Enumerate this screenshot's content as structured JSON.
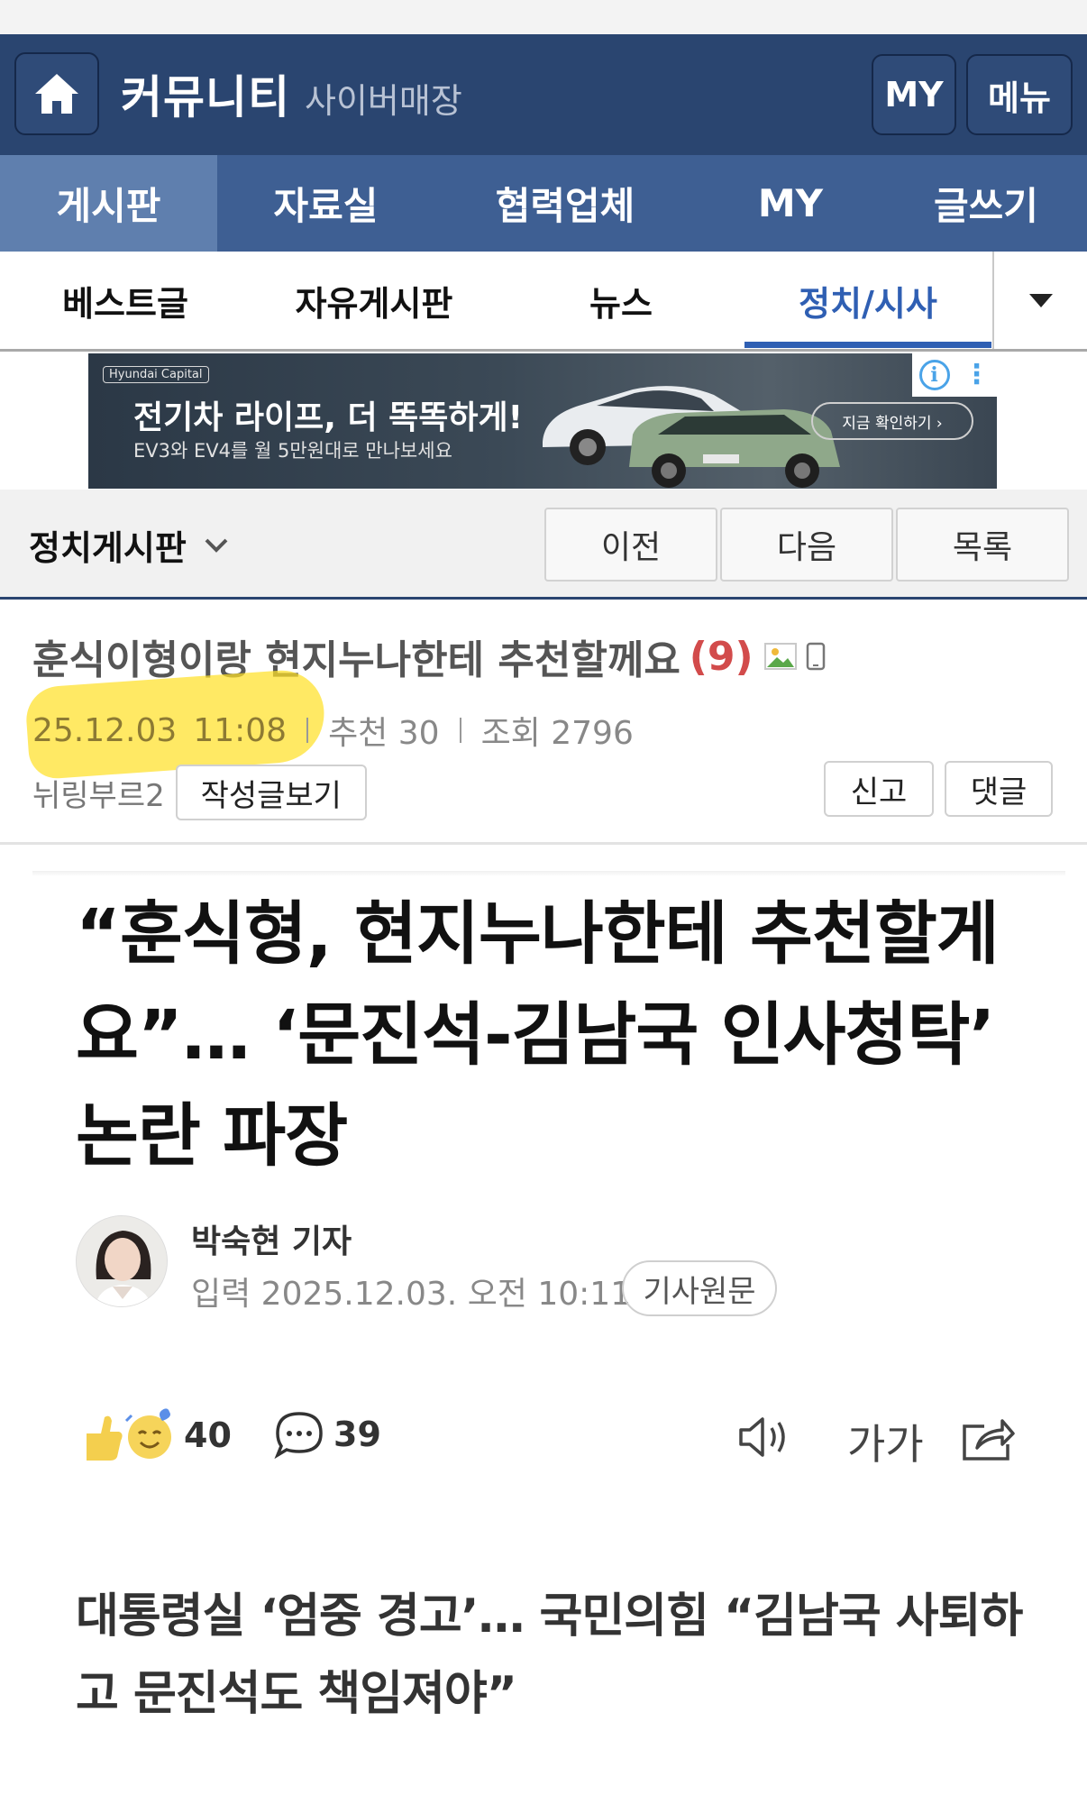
{
  "header": {
    "title": "커뮤니티",
    "subtitle": "사이버매장",
    "my_label": "MY",
    "menu_label": "메뉴"
  },
  "main_nav": {
    "items": [
      {
        "label": "게시판",
        "active": true
      },
      {
        "label": "자료실",
        "active": false
      },
      {
        "label": "협력업체",
        "active": false
      },
      {
        "label": "MY",
        "active": false
      },
      {
        "label": "글쓰기",
        "active": false
      }
    ]
  },
  "sub_nav": {
    "items": [
      {
        "label": "베스트글",
        "active": false
      },
      {
        "label": "자유게시판",
        "active": false
      },
      {
        "label": "뉴스",
        "active": false
      },
      {
        "label": "정치/시사",
        "active": true
      }
    ]
  },
  "ad": {
    "brand": "Hyundai Capital",
    "headline": "전기차 라이프, 더 똑똑하게!",
    "subline": "EV3와 EV4를 월 5만원대로 만나보세요",
    "cta": "지금 확인하기 ›"
  },
  "board": {
    "name": "정치게시판",
    "prev_label": "이전",
    "next_label": "다음",
    "list_label": "목록"
  },
  "post": {
    "title": "훈식이형이랑 현지누나한테 추천할께요",
    "comment_count": "(9)",
    "date": "25.12.03",
    "time": "11:08",
    "recommend": "추천 30",
    "views": "조회 2796",
    "author": "뉘링부르2",
    "view_posts_label": "작성글보기",
    "report_label": "신고",
    "comment_label": "댓글"
  },
  "article": {
    "headline": "“훈식형, 현지누나한테 추천할게요”… ‘문진석-김남국 인사청탁’ 논란 파장",
    "reporter": "박숙현 기자",
    "input_time": "입력 2025.12.03. 오전 10:11",
    "original_label": "기사원문",
    "reactions": "40",
    "comments": "39",
    "font_size_label": "가가",
    "subheadline": "대통령실 ‘엄중 경고’… 국민의힘 “김남국 사퇴하고 문진석도 책임져야”"
  },
  "colors": {
    "header_bg": "#2a4570",
    "nav_bg": "#3e5f93",
    "nav_active": "#5f7fae",
    "accent_blue": "#2f5fb3",
    "comment_count": "#d24b4b",
    "highlight": "#ffe028"
  }
}
